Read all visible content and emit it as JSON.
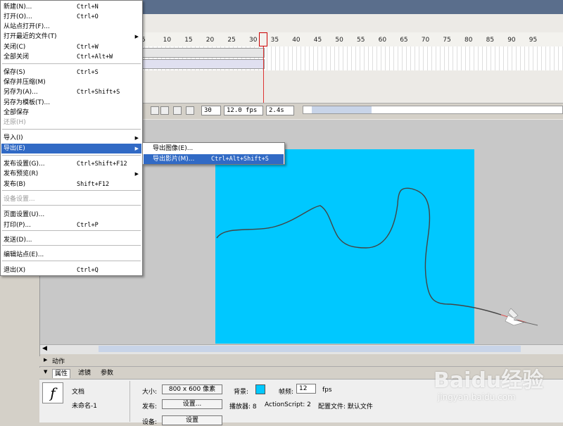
{
  "file_menu": {
    "items": [
      {
        "label": "新建(N)...",
        "shortcut": "Ctrl+N"
      },
      {
        "label": "打开(O)...",
        "shortcut": "Ctrl+O"
      },
      {
        "label": "从站点打开(F)...",
        "shortcut": ""
      },
      {
        "label": "打开最近的文件(T)",
        "shortcut": "",
        "submenu": true
      },
      {
        "label": "关闭(C)",
        "shortcut": "Ctrl+W"
      },
      {
        "label": "全部关闭",
        "shortcut": "Ctrl+Alt+W"
      },
      {
        "label": "保存(S)",
        "shortcut": "Ctrl+S"
      },
      {
        "label": "保存并压缩(M)",
        "shortcut": ""
      },
      {
        "label": "另存为(A)...",
        "shortcut": "Ctrl+Shift+S"
      },
      {
        "label": "另存为模板(T)...",
        "shortcut": ""
      },
      {
        "label": "全部保存",
        "shortcut": ""
      },
      {
        "label": "还原(H)",
        "shortcut": "",
        "disabled": true
      },
      {
        "label": "导入(I)",
        "shortcut": "",
        "submenu": true
      },
      {
        "label": "导出(E)",
        "shortcut": "",
        "submenu": true,
        "highlighted": true
      },
      {
        "label": "发布设置(G)...",
        "shortcut": "Ctrl+Shift+F12"
      },
      {
        "label": "发布预览(R)",
        "shortcut": "",
        "submenu": true
      },
      {
        "label": "发布(B)",
        "shortcut": "Shift+F12"
      },
      {
        "label": "设备设置...",
        "shortcut": "",
        "disabled": true
      },
      {
        "label": "页面设置(U)...",
        "shortcut": ""
      },
      {
        "label": "打印(P)...",
        "shortcut": "Ctrl+P"
      },
      {
        "label": "发送(D)...",
        "shortcut": ""
      },
      {
        "label": "编辑站点(E)...",
        "shortcut": ""
      },
      {
        "label": "退出(X)",
        "shortcut": "Ctrl+Q"
      }
    ]
  },
  "export_submenu": {
    "items": [
      {
        "label": "导出图像(E)...",
        "shortcut": ""
      },
      {
        "label": "导出影片(M)...",
        "shortcut": "Ctrl+Alt+Shift+S",
        "highlighted": true
      }
    ]
  },
  "timeline": {
    "ruler_ticks": [
      "5",
      "10",
      "15",
      "20",
      "25",
      "30",
      "35",
      "40",
      "45",
      "50",
      "55",
      "60",
      "65",
      "70",
      "75",
      "80",
      "85",
      "90",
      "95"
    ],
    "current_frame": "30",
    "frame_rate": "12.0 fps",
    "elapsed_time": "2.4s"
  },
  "panels": {
    "actions_label": "动作",
    "tabs": [
      "属性",
      "滤镜",
      "参数"
    ]
  },
  "properties": {
    "doc_type": "文档",
    "doc_name": "未命名-1",
    "size_label": "大小:",
    "size_value": "800 x 600 像素",
    "background_label": "背景:",
    "background_color": "#00c8ff",
    "fps_label": "帧频:",
    "fps_value": "12",
    "fps_unit": "fps",
    "publish_label": "发布:",
    "settings_button": "设置...",
    "player_text": "播放器: 8",
    "actionscript_text": "ActionScript: 2",
    "profile_text": "配置文件: 默认文件",
    "settings2_label": "设备:",
    "settings2_button": "设置"
  },
  "watermark": {
    "logo": "Baidu经验",
    "url": "jingyan.baidu.com"
  },
  "colors": {
    "menu_highlight": "#316ac5",
    "stage": "#00c8ff",
    "playhead": "#dd3333"
  }
}
